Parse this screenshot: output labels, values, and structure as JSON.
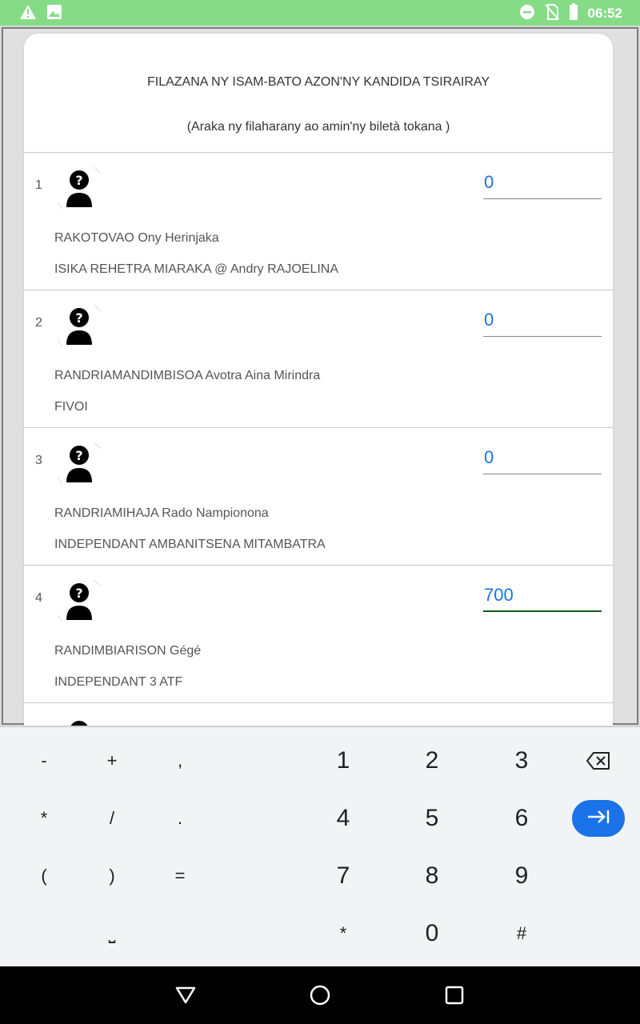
{
  "status_bar": {
    "time": "06:52",
    "icons": [
      "warning-icon",
      "image-icon",
      "dnd-icon",
      "no-sim-icon",
      "battery-icon"
    ],
    "background": "#86dc86"
  },
  "header": {
    "title": "FILAZANA NY ISAM-BATO AZON'NY KANDIDA TSIRAIRAY",
    "subtitle": "(Araka ny filaharany ao amin'ny biletà tokana )"
  },
  "candidates": [
    {
      "number": "1",
      "name": "RAKOTOVAO Ony Herinjaka",
      "party": "ISIKA REHETRA MIARAKA @ Andry RAJOELINA",
      "votes": "0"
    },
    {
      "number": "2",
      "name": "RANDRIAMANDIMBISOA Avotra Aina Mirindra",
      "party": "FIVOI",
      "votes": "0"
    },
    {
      "number": "3",
      "name": "RANDRIAMIHAJA Rado Nampionona",
      "party": "INDEPENDANT AMBANITSENA MITAMBATRA",
      "votes": "0"
    },
    {
      "number": "4",
      "name": "RANDIMBIARISON Gégé",
      "party": "INDEPENDANT 3 ATF",
      "votes": "700"
    }
  ],
  "keyboard": {
    "row1": [
      "-",
      "+",
      ",",
      "1",
      "2",
      "3"
    ],
    "row2": [
      "*",
      "/",
      ".",
      "4",
      "5",
      "6"
    ],
    "row3": [
      "(",
      ")",
      "=",
      "7",
      "8",
      "9"
    ],
    "row4": [
      "⎵",
      "*",
      "0",
      "#"
    ],
    "accent": "#1a73e8"
  }
}
